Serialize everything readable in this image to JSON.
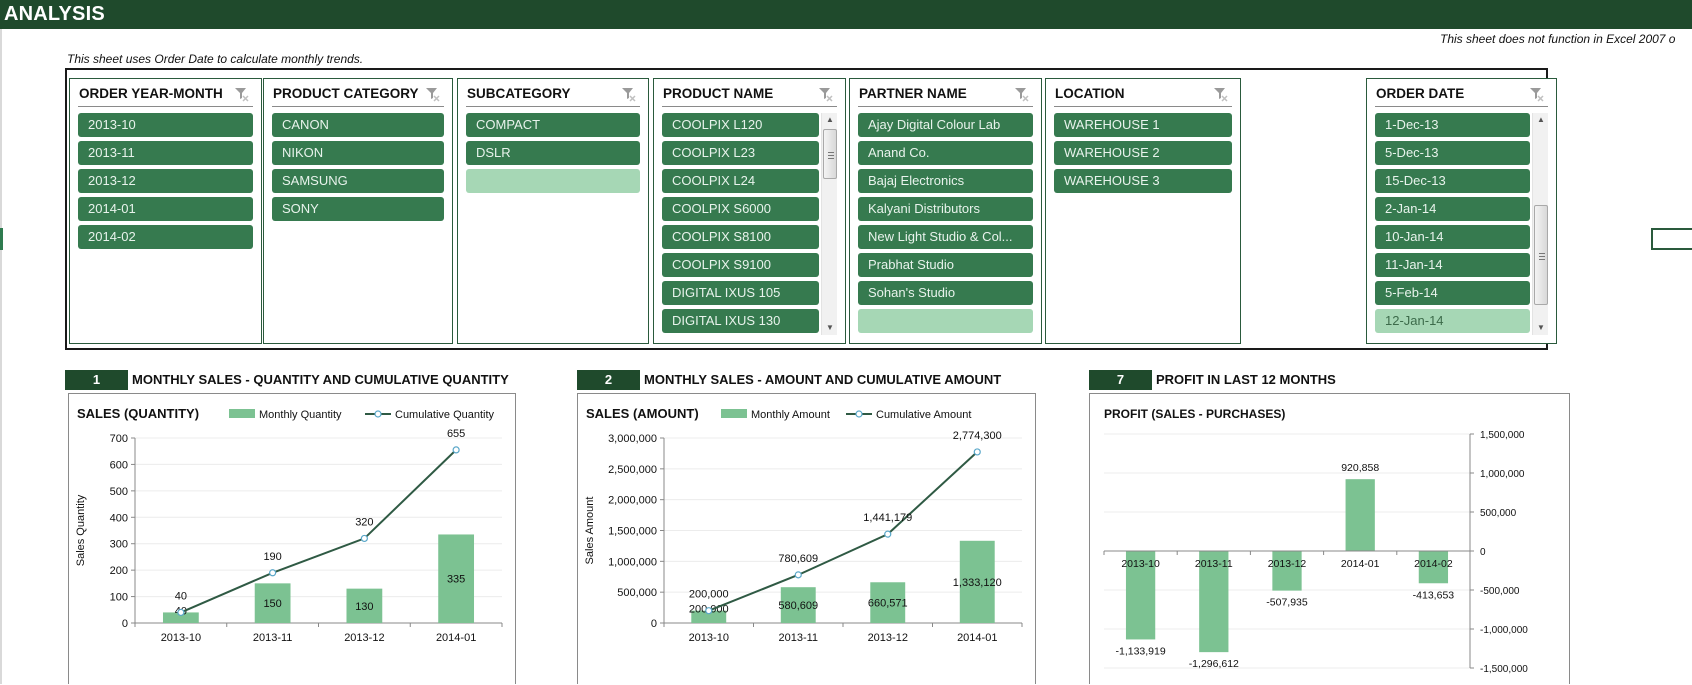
{
  "header": {
    "title": "ANALYSIS",
    "note_left": "This sheet uses Order Date to calculate monthly trends.",
    "note_right": "This sheet does not function in Excel 2007 o"
  },
  "colors": {
    "header_bg": "#1f4a2c",
    "slicer_item": "#367a4f",
    "slicer_item_nodata": "#a6d7b5",
    "bar": "#7cc292",
    "line": "#2f5a44",
    "marker": "#5aa7c9"
  },
  "slicers": [
    {
      "id": "order-year-month",
      "title": "ORDER YEAR-MONTH",
      "clear_icon": "clear-filter-icon",
      "items": [
        {
          "label": "2013-10"
        },
        {
          "label": "2013-11"
        },
        {
          "label": "2013-12"
        },
        {
          "label": "2014-01"
        },
        {
          "label": "2014-02"
        }
      ]
    },
    {
      "id": "product-category",
      "title": "PRODUCT CATEGORY",
      "clear_icon": "clear-filter-icon",
      "items": [
        {
          "label": "CANON"
        },
        {
          "label": "NIKON"
        },
        {
          "label": "SAMSUNG"
        },
        {
          "label": "SONY"
        }
      ]
    },
    {
      "id": "subcategory",
      "title": "SUBCATEGORY",
      "clear_icon": "clear-filter-icon",
      "items": [
        {
          "label": "COMPACT"
        },
        {
          "label": "DSLR"
        },
        {
          "label": "",
          "nodata": true
        }
      ]
    },
    {
      "id": "product-name",
      "title": "PRODUCT NAME",
      "clear_icon": "clear-filter-icon",
      "scrollable": true,
      "items": [
        {
          "label": "COOLPIX L120"
        },
        {
          "label": "COOLPIX L23"
        },
        {
          "label": "COOLPIX L24"
        },
        {
          "label": "COOLPIX S6000"
        },
        {
          "label": "COOLPIX S8100"
        },
        {
          "label": "COOLPIX S9100"
        },
        {
          "label": "DIGITAL IXUS 105"
        },
        {
          "label": "DIGITAL IXUS 130"
        }
      ]
    },
    {
      "id": "partner-name",
      "title": "PARTNER NAME",
      "clear_icon": "clear-filter-icon",
      "items": [
        {
          "label": "Ajay Digital Colour Lab"
        },
        {
          "label": "Anand Co."
        },
        {
          "label": "Bajaj Electronics"
        },
        {
          "label": "Kalyani Distributors"
        },
        {
          "label": "New Light Studio & Col..."
        },
        {
          "label": "Prabhat Studio"
        },
        {
          "label": "Sohan's Studio"
        },
        {
          "label": "",
          "nodata": true
        }
      ]
    },
    {
      "id": "location",
      "title": "LOCATION",
      "clear_icon": "clear-filter-icon",
      "items": [
        {
          "label": "WAREHOUSE 1"
        },
        {
          "label": "WAREHOUSE 2"
        },
        {
          "label": "WAREHOUSE 3"
        }
      ]
    },
    {
      "id": "order-date",
      "title": "ORDER DATE",
      "clear_icon": "clear-filter-icon",
      "scrollable": true,
      "items": [
        {
          "label": "1-Dec-13"
        },
        {
          "label": "5-Dec-13"
        },
        {
          "label": "15-Dec-13"
        },
        {
          "label": "2-Jan-14"
        },
        {
          "label": "10-Jan-14"
        },
        {
          "label": "11-Jan-14"
        },
        {
          "label": "5-Feb-14"
        },
        {
          "label": "12-Jan-14",
          "nodata": true
        }
      ]
    }
  ],
  "sections": [
    {
      "number": "1",
      "title": "MONTHLY SALES - QUANTITY AND CUMULATIVE QUANTITY"
    },
    {
      "number": "2",
      "title": "MONTHLY SALES - AMOUNT AND CUMULATIVE AMOUNT"
    },
    {
      "number": "7",
      "title": "PROFIT IN LAST 12 MONTHS"
    }
  ],
  "chart_data": [
    {
      "type": "bar",
      "title": "SALES (QUANTITY)",
      "xlabel": "",
      "ylabel": "Sales Quantity",
      "ylim": [
        0,
        700
      ],
      "yticks": [
        0,
        100,
        200,
        300,
        400,
        500,
        600,
        700
      ],
      "ytick_labels": [
        "0",
        "100",
        "200",
        "300",
        "400",
        "500",
        "600",
        "700"
      ],
      "categories": [
        "2013-10",
        "2013-11",
        "2013-12",
        "2014-01"
      ],
      "series": [
        {
          "name": "Monthly Quantity",
          "kind": "bar",
          "values": [
            40,
            150,
            130,
            335
          ],
          "labels": [
            "40",
            "150",
            "130",
            "335"
          ]
        },
        {
          "name": "Cumulative Quantity",
          "kind": "line",
          "values": [
            40,
            190,
            320,
            655
          ],
          "labels": [
            "40",
            "190",
            "320",
            "655"
          ]
        }
      ],
      "legend": "top",
      "grid": true
    },
    {
      "type": "bar",
      "title": "SALES (AMOUNT)",
      "xlabel": "",
      "ylabel": "Sales Amount",
      "ylim": [
        0,
        3000000
      ],
      "yticks": [
        0,
        500000,
        1000000,
        1500000,
        2000000,
        2500000,
        3000000
      ],
      "ytick_labels": [
        "0",
        "500,000",
        "1,000,000",
        "1,500,000",
        "2,000,000",
        "2,500,000",
        "3,000,000"
      ],
      "categories": [
        "2013-10",
        "2013-11",
        "2013-12",
        "2014-01"
      ],
      "series": [
        {
          "name": "Monthly Amount",
          "kind": "bar",
          "values": [
            200000,
            580609,
            660571,
            1333120
          ],
          "labels": [
            "200,000",
            "580,609",
            "660,571",
            "1,333,120"
          ]
        },
        {
          "name": "Cumulative Amount",
          "kind": "line",
          "values": [
            200000,
            780609,
            1441179,
            2774300
          ],
          "labels": [
            "200,000",
            "780,609",
            "1,441,179",
            "2,774,300"
          ]
        }
      ],
      "legend": "top",
      "grid": true
    },
    {
      "type": "bar",
      "title": "PROFIT (SALES - PURCHASES)",
      "xlabel": "",
      "ylabel": "",
      "ylim": [
        -1500000,
        1500000
      ],
      "yticks": [
        -1500000,
        -1000000,
        -500000,
        0,
        500000,
        1000000,
        1500000
      ],
      "ytick_labels": [
        "-1,500,000",
        "-1,000,000",
        "-500,000",
        "0",
        "500,000",
        "1,000,000",
        "1,500,000"
      ],
      "yaxis_side": "right",
      "categories": [
        "2013-10",
        "2013-11",
        "2013-12",
        "2014-01",
        "2014-02"
      ],
      "series": [
        {
          "name": "Profit",
          "kind": "bar",
          "values": [
            -1133919,
            -1296612,
            -507935,
            920858,
            -413653
          ],
          "labels": [
            "-1,133,919",
            "-1,296,612",
            "-507,935",
            "920,858",
            "-413,653"
          ]
        }
      ],
      "legend": "none",
      "grid": true
    }
  ]
}
